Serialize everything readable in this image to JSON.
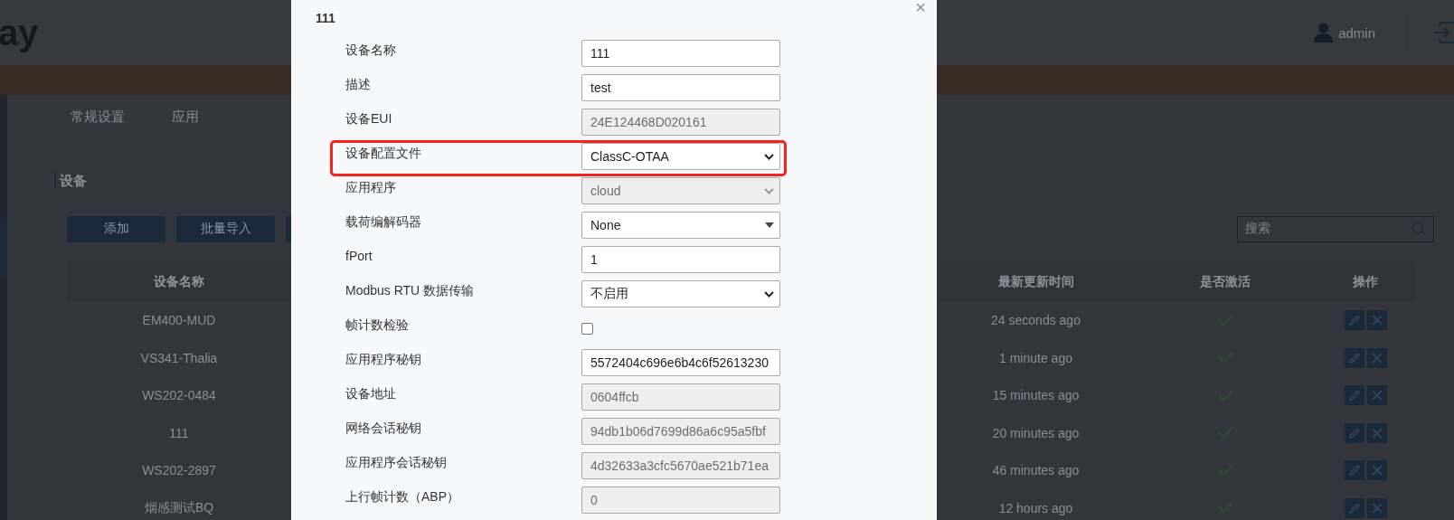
{
  "header": {
    "logo": "ay",
    "user": "admin"
  },
  "tabs": [
    {
      "label": "常规设置",
      "selected": false
    },
    {
      "label": "应用",
      "selected": false
    }
  ],
  "section_title": "设备",
  "actions": [
    {
      "label": "添加"
    },
    {
      "label": "批量导入"
    }
  ],
  "search": {
    "placeholder": "搜索"
  },
  "table": {
    "columns": [
      "设备名称",
      "最新更新时间",
      "是否激活",
      "操作"
    ],
    "rows": [
      {
        "name": "EM400-MUD",
        "updated": "24 seconds ago",
        "active": true
      },
      {
        "name": "VS341-Thalia",
        "updated": "1 minute ago",
        "active": true
      },
      {
        "name": "WS202-0484",
        "updated": "15 minutes ago",
        "active": true
      },
      {
        "name": "111",
        "updated": "20 minutes ago",
        "active": true
      },
      {
        "name": "WS202-2897",
        "updated": "46 minutes ago",
        "active": true
      },
      {
        "name": "烟感测试BQ",
        "updated": "12 hours ago",
        "active": true
      }
    ]
  },
  "dialog": {
    "title": "111",
    "close": "×",
    "fields": [
      {
        "label": "设备名称",
        "kind": "input",
        "value": "111",
        "disabled": false,
        "highlighted": false
      },
      {
        "label": "描述",
        "kind": "input",
        "value": "test",
        "disabled": false,
        "highlighted": false
      },
      {
        "label": "设备EUI",
        "kind": "input",
        "value": "24E124468D020161",
        "disabled": true,
        "highlighted": false
      },
      {
        "label": "设备配置文件",
        "kind": "select",
        "value": "ClassC-OTAA",
        "disabled": false,
        "highlighted": true
      },
      {
        "label": "应用程序",
        "kind": "select",
        "value": "cloud",
        "disabled": true,
        "highlighted": false
      },
      {
        "label": "载荷编解码器",
        "kind": "combo",
        "value": "None",
        "disabled": false,
        "highlighted": false
      },
      {
        "label": "fPort",
        "kind": "input",
        "value": "1",
        "disabled": false,
        "highlighted": false
      },
      {
        "label": "Modbus RTU 数据传输",
        "kind": "select",
        "value": "不启用",
        "disabled": false,
        "highlighted": false
      },
      {
        "label": "帧计数检验",
        "kind": "checkbox",
        "checked": false,
        "highlighted": false
      },
      {
        "label": "应用程序秘钥",
        "kind": "input",
        "value": "5572404c696e6b4c6f52613230",
        "disabled": false,
        "highlighted": false
      },
      {
        "label": "设备地址",
        "kind": "input",
        "value": "0604ffcb",
        "disabled": true,
        "highlighted": false
      },
      {
        "label": "网络会话秘钥",
        "kind": "input",
        "value": "94db1b06d7699d86a6c95a5fbf",
        "disabled": true,
        "highlighted": false
      },
      {
        "label": "应用程序会话秘钥",
        "kind": "input",
        "value": "4d32633a3cfc5670ae521b71ea",
        "disabled": true,
        "highlighted": false
      },
      {
        "label": "上行帧计数（ABP）",
        "kind": "input",
        "value": "0",
        "disabled": true,
        "highlighted": false
      }
    ]
  }
}
